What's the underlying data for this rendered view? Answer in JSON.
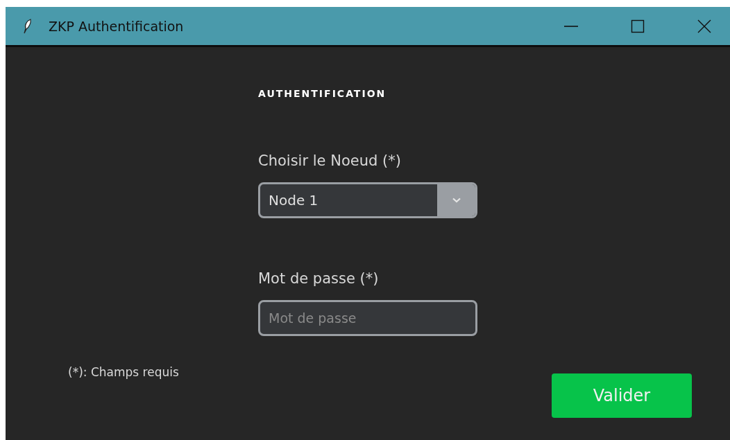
{
  "window": {
    "title": "ZKP Authentification"
  },
  "heading": "AUTHENTIFICATION",
  "fields": [
    {
      "kind": "select",
      "label": "Choisir le Noeud (*)",
      "value": "Node 1"
    },
    {
      "kind": "password",
      "label": "Mot de passe (*)",
      "placeholder": "Mot de passe"
    }
  ],
  "note": "(*): Champs requis",
  "submit_button": "Valider"
}
